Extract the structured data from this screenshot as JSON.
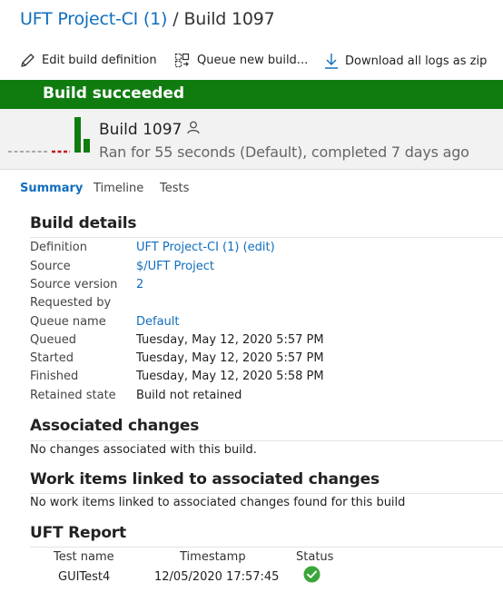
{
  "breadcrumb": {
    "definition": "UFT Project-CI (1)",
    "separator": "/",
    "current": "Build 1097"
  },
  "toolbar": {
    "edit_label": "Edit build definition",
    "queue_label": "Queue new build...",
    "download_label": "Download all logs as zip"
  },
  "banner": {
    "text": "Build succeeded",
    "color": "#107c10"
  },
  "build": {
    "title": "Build 1097",
    "summary": "Ran for 55 seconds (Default), completed 7 days ago",
    "icons": {
      "requester": "person-icon"
    }
  },
  "tabs": [
    {
      "label": "Summary",
      "active": true
    },
    {
      "label": "Timeline",
      "active": false
    },
    {
      "label": "Tests",
      "active": false
    }
  ],
  "build_details": {
    "title": "Build details",
    "rows": [
      {
        "label": "Definition",
        "value": "UFT Project-CI (1) (edit)",
        "link": true
      },
      {
        "label": "Source",
        "value": "$/UFT Project",
        "link": true
      },
      {
        "label": "Source version",
        "value": "2",
        "link": true
      },
      {
        "label": "Requested by",
        "value": "",
        "link": false
      },
      {
        "label": "Queue name",
        "value": "Default",
        "link": true
      },
      {
        "label": "Queued",
        "value": "Tuesday, May 12, 2020 5:57 PM",
        "link": false
      },
      {
        "label": "Started",
        "value": "Tuesday, May 12, 2020 5:57 PM",
        "link": false
      },
      {
        "label": "Finished",
        "value": "Tuesday, May 12, 2020 5:58 PM",
        "link": false
      },
      {
        "label": "Retained state",
        "value": "Build not retained",
        "link": false
      }
    ]
  },
  "associated_changes": {
    "title": "Associated changes",
    "message": "No changes associated with this build."
  },
  "work_items": {
    "title": "Work items linked to associated changes",
    "message": "No work items linked to associated changes found for this build"
  },
  "uft_report": {
    "title": "UFT Report",
    "headers": [
      "Test name",
      "Timestamp",
      "Status"
    ],
    "rows": [
      {
        "test_name": "GUITest4",
        "timestamp": "12/05/2020 17:57:45",
        "status": "passed",
        "status_icon": "check-circle-icon",
        "status_color": "#3aa63a"
      }
    ]
  }
}
